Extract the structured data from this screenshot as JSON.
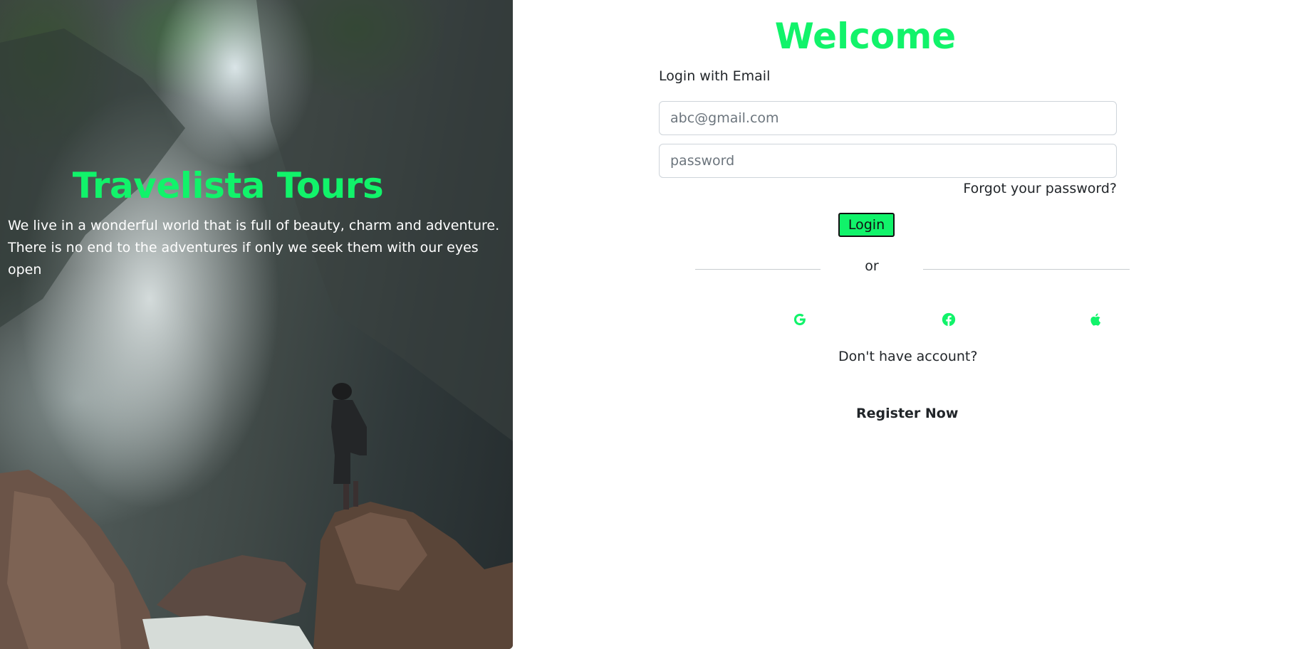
{
  "hero": {
    "title": "Travelista Tours",
    "tagline_line1": "We live in a wonderful world that is full of beauty, charm and adventure.",
    "tagline_line2": "There is no end to the adventures if only we seek them with our eyes open"
  },
  "login": {
    "heading": "Welcome",
    "subheading": "Login with Email",
    "email_placeholder": "abc@gmail.com",
    "password_placeholder": "password",
    "forgot_label": "Forgot your password?",
    "login_button": "Login",
    "divider_text": "or",
    "social": [
      {
        "icon": "google-icon"
      },
      {
        "icon": "facebook-icon"
      },
      {
        "icon": "apple-icon"
      }
    ],
    "no_account_text": "Don't have account?",
    "register_label": "Register Now"
  },
  "colors": {
    "accent": "#11f36a",
    "text": "#212529",
    "border": "#ced4da"
  }
}
